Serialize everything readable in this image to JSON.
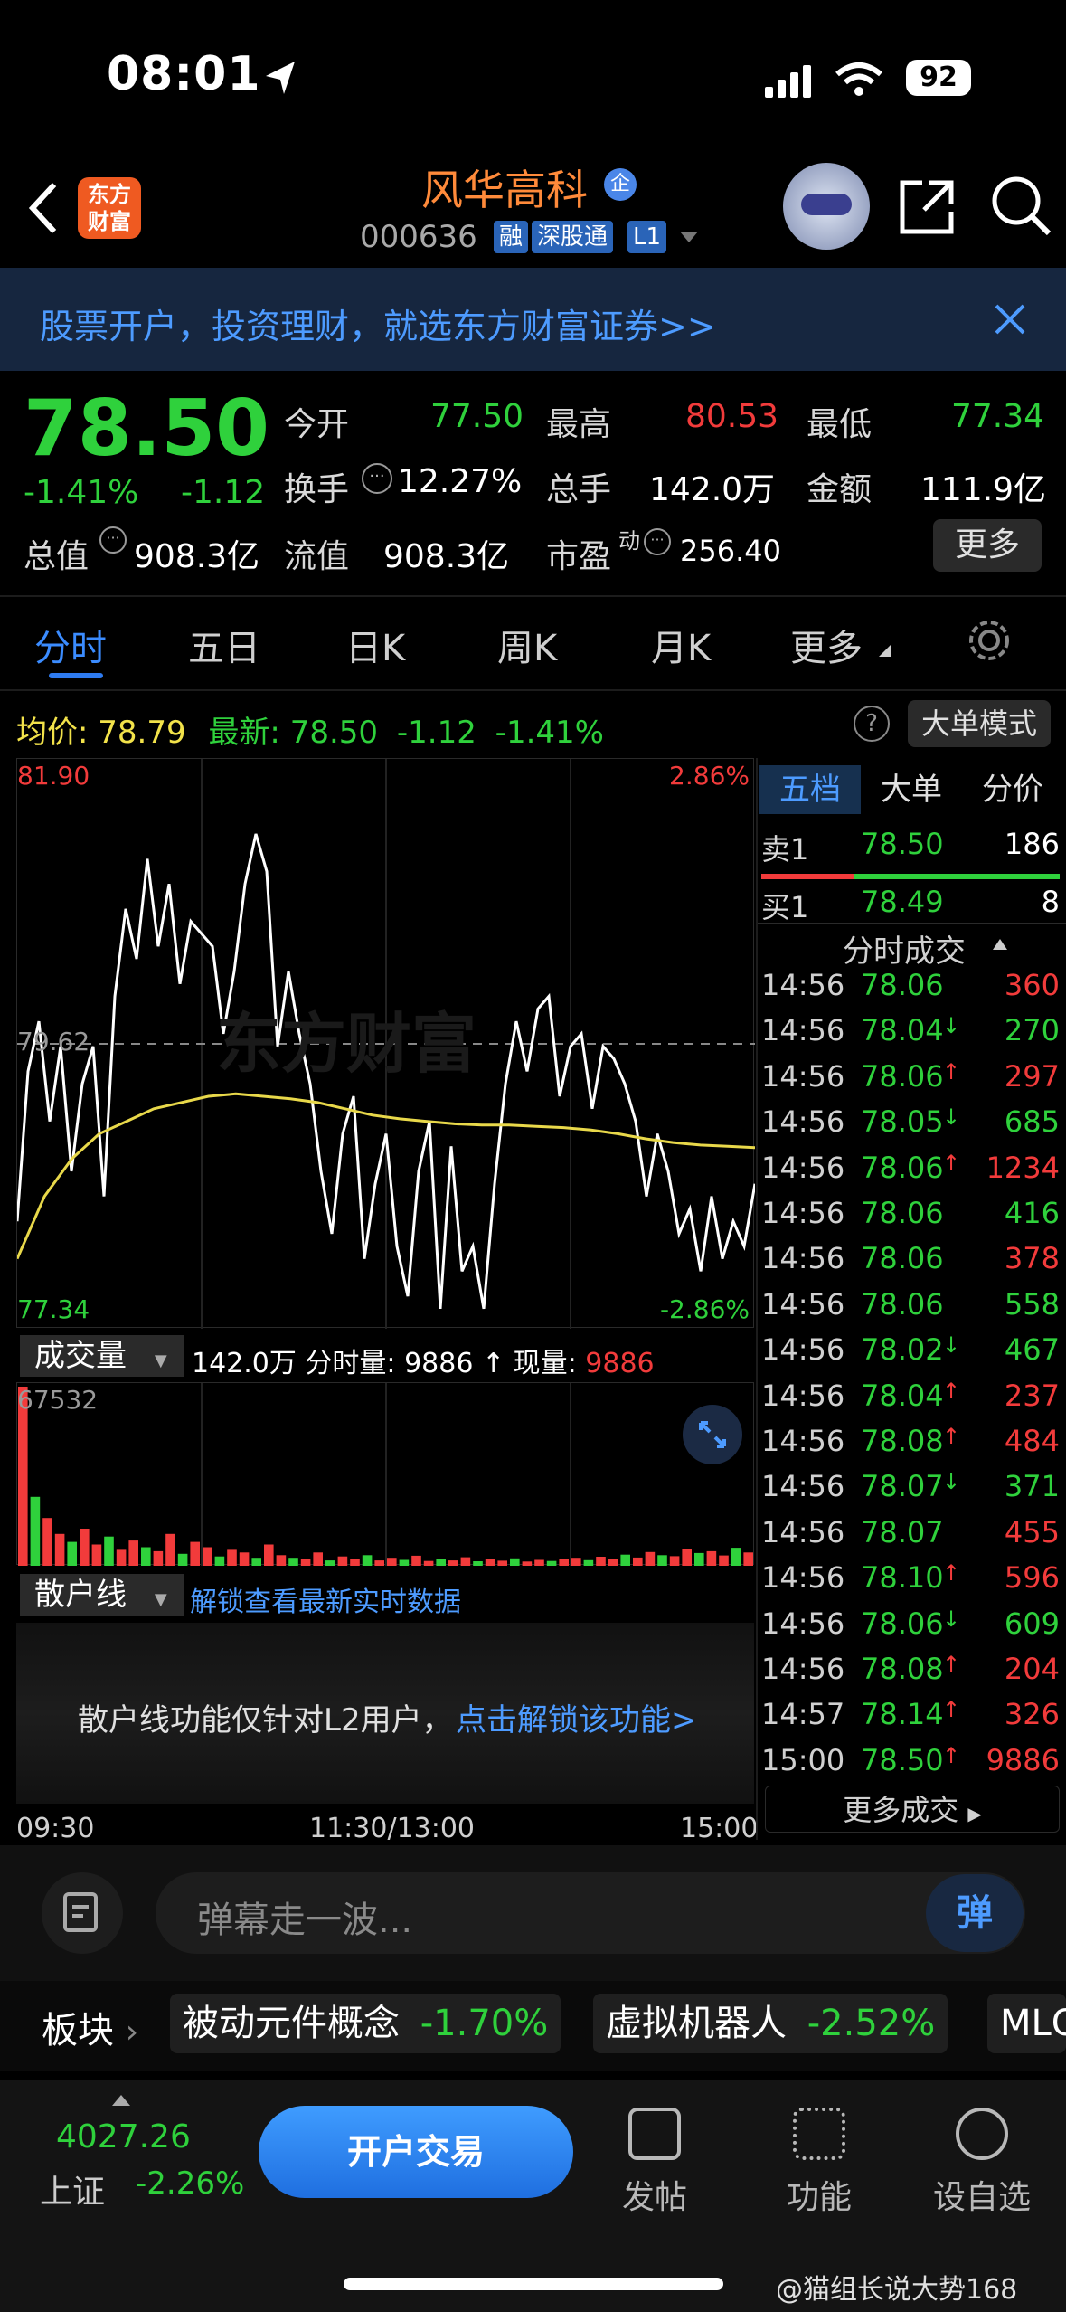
{
  "status": {
    "time": "08:01",
    "battery": "92"
  },
  "header": {
    "logo": "东方财富",
    "name": "风华高科",
    "name_badge": "企",
    "code": "000636",
    "tags": [
      "融",
      "深股通",
      "L1"
    ]
  },
  "banner": {
    "text": "股票开户，投资理财，就选东方财富证券>>"
  },
  "quote": {
    "price": "78.50",
    "change_pct": "-1.41%",
    "change": "-1.12",
    "open_label": "今开",
    "open": "77.50",
    "high_label": "最高",
    "high": "80.53",
    "low_label": "最低",
    "low": "77.34",
    "turnover_label": "换手",
    "turnover": "12.27%",
    "volume_label": "总手",
    "volume": "142.0万",
    "amount_label": "金额",
    "amount": "111.9亿",
    "mktcap_label": "总值",
    "mktcap": "908.3亿",
    "float_label": "流值",
    "float": "908.3亿",
    "pe_label": "市盈",
    "pe_sup": "动",
    "pe": "256.40",
    "more": "更多"
  },
  "tabs": [
    "分时",
    "五日",
    "日K",
    "周K",
    "月K",
    "更多"
  ],
  "avg_row": {
    "avg_label": "均价:",
    "avg": "78.79",
    "latest_label": "最新:",
    "latest": "78.50",
    "chg": "-1.12",
    "chg_pct": "-1.41%",
    "big_order": "大单模式"
  },
  "chart": {
    "top_price": "81.90",
    "mid_price": "79.62",
    "bottom_price": "77.34",
    "top_pct": "2.86%",
    "bottom_pct": "-2.86%",
    "watermark": "东方财富"
  },
  "volume": {
    "label": "成交量",
    "summary_total": "142.0万",
    "summary_rest": "分时量: 9886 ↑ 现量:",
    "now": "9886",
    "max": "67532"
  },
  "retail": {
    "label": "散户线",
    "unlock_hint": "解锁查看最新实时数据",
    "lock_text": "散户线功能仅针对L2用户，",
    "lock_link": "点击解锁该功能>"
  },
  "time_axis": [
    "09:30",
    "11:30/13:00",
    "15:00"
  ],
  "order_panel": {
    "tabs": [
      "五档",
      "大单",
      "分价"
    ],
    "sell1": {
      "label": "卖1",
      "price": "78.50",
      "vol": "186"
    },
    "buy1": {
      "label": "买1",
      "price": "78.49",
      "vol": "8"
    },
    "ticks_title": "分时成交",
    "more_trades": "更多成交",
    "ticks": [
      {
        "t": "14:56",
        "p": "78.06",
        "d": "",
        "v": "360",
        "c": "red"
      },
      {
        "t": "14:56",
        "p": "78.04",
        "d": "↓",
        "v": "270",
        "c": "green"
      },
      {
        "t": "14:56",
        "p": "78.06",
        "d": "↑",
        "v": "297",
        "c": "red"
      },
      {
        "t": "14:56",
        "p": "78.05",
        "d": "↓",
        "v": "685",
        "c": "green"
      },
      {
        "t": "14:56",
        "p": "78.06",
        "d": "↑",
        "v": "1234",
        "c": "red"
      },
      {
        "t": "14:56",
        "p": "78.06",
        "d": "",
        "v": "416",
        "c": "green"
      },
      {
        "t": "14:56",
        "p": "78.06",
        "d": "",
        "v": "378",
        "c": "red"
      },
      {
        "t": "14:56",
        "p": "78.06",
        "d": "",
        "v": "558",
        "c": "green"
      },
      {
        "t": "14:56",
        "p": "78.02",
        "d": "↓",
        "v": "467",
        "c": "green"
      },
      {
        "t": "14:56",
        "p": "78.04",
        "d": "↑",
        "v": "237",
        "c": "red"
      },
      {
        "t": "14:56",
        "p": "78.08",
        "d": "↑",
        "v": "484",
        "c": "red"
      },
      {
        "t": "14:56",
        "p": "78.07",
        "d": "↓",
        "v": "371",
        "c": "green"
      },
      {
        "t": "14:56",
        "p": "78.07",
        "d": "",
        "v": "455",
        "c": "red"
      },
      {
        "t": "14:56",
        "p": "78.10",
        "d": "↑",
        "v": "596",
        "c": "red"
      },
      {
        "t": "14:56",
        "p": "78.06",
        "d": "↓",
        "v": "609",
        "c": "green"
      },
      {
        "t": "14:56",
        "p": "78.08",
        "d": "↑",
        "v": "204",
        "c": "red"
      },
      {
        "t": "14:57",
        "p": "78.14",
        "d": "↑",
        "v": "326",
        "c": "red"
      },
      {
        "t": "15:00",
        "p": "78.50",
        "d": "↑",
        "v": "9886",
        "c": "red"
      }
    ]
  },
  "comment": {
    "placeholder": "弹幕走一波...",
    "danmu": "弹"
  },
  "sectors": {
    "label": "板块",
    "items": [
      {
        "name": "被动元件概念",
        "chg": "-1.70%"
      },
      {
        "name": "虚拟机器人",
        "chg": "-2.52%"
      },
      {
        "name": "MLC",
        "chg": ""
      }
    ]
  },
  "bottom": {
    "index_value": "4027.26",
    "index_name": "上证",
    "index_chg": "-2.26%",
    "open_trade": "开户交易",
    "nav": [
      "发帖",
      "功能",
      "设自选"
    ],
    "watermark": "@猫组长说大势168"
  },
  "chart_data": {
    "type": "line",
    "x_range": [
      "09:30",
      "15:00"
    ],
    "ylim": [
      77.34,
      81.9
    ],
    "reference": 79.62,
    "series": [
      {
        "values": [
          78.2,
          79.4,
          79.8,
          79.0,
          79.6,
          78.6,
          79.3,
          79.6,
          78.4,
          80.0,
          80.7,
          80.3,
          81.1,
          80.4,
          80.9,
          80.1,
          80.6,
          80.5,
          80.4,
          79.7,
          80.2,
          80.9,
          81.3,
          81.0,
          79.6,
          80.2,
          79.7,
          79.3,
          78.6,
          78.1,
          78.9,
          79.2,
          77.9,
          78.5,
          78.9,
          78.0,
          77.6,
          78.6,
          79.0,
          77.5,
          78.8,
          77.8,
          78.0,
          77.5,
          78.5,
          79.3,
          79.8,
          79.4,
          79.9,
          80.0,
          79.2,
          79.6,
          79.7,
          79.1,
          79.6,
          79.5,
          79.3,
          79.0,
          78.4,
          78.9,
          78.6,
          78.1,
          78.3,
          77.8,
          78.4,
          77.9,
          78.2,
          78.0,
          78.5
        ]
      },
      {
        "values": [
          77.9,
          78.4,
          78.7,
          78.9,
          79.0,
          79.1,
          79.15,
          79.2,
          79.22,
          79.2,
          79.18,
          79.15,
          79.1,
          79.05,
          79.02,
          79.0,
          78.98,
          78.97,
          78.97,
          78.96,
          78.95,
          78.93,
          78.9,
          78.86,
          78.83,
          78.81,
          78.8,
          78.79
        ]
      }
    ],
    "volume": [
      67532,
      26000,
      18000,
      12000,
      9000,
      14000,
      8000,
      11000,
      6000,
      9500,
      7000,
      5500,
      12000,
      4500,
      9000,
      7000,
      3500,
      6000,
      5000,
      3000,
      8000,
      4000,
      3000,
      2500,
      5000,
      2000,
      3500,
      2500,
      4000,
      2000,
      3000,
      2200,
      3800,
      1800,
      2600,
      2000,
      3200,
      1700,
      2400,
      1900,
      2800,
      1600,
      2200,
      1800,
      2500,
      3000,
      2100,
      3400,
      2600,
      4200,
      3100,
      5200,
      4000,
      3600,
      6200,
      4800,
      5500,
      3900,
      6800,
      5000
    ]
  }
}
